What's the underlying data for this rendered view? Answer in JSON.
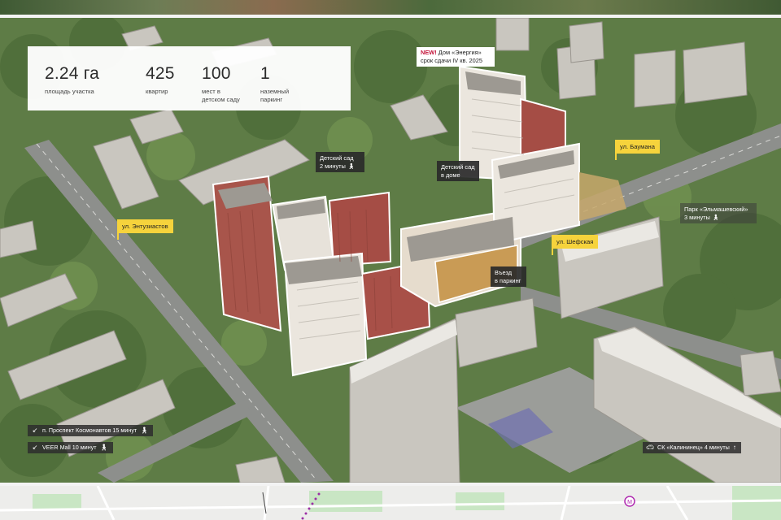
{
  "stats": [
    {
      "value": "2.24 га",
      "label": "площадь участка"
    },
    {
      "value": "425",
      "label": "квартир"
    },
    {
      "value": "100",
      "label": "мест в детском саду"
    },
    {
      "value": "1",
      "label": "наземный паркинг"
    }
  ],
  "new_building": {
    "new_tag": "NEW!",
    "title": "Дом «Энергия»",
    "deadline": "срок сдачи IV кв. 2025"
  },
  "callouts": {
    "kindergarten_near": {
      "line1": "Детский сад",
      "line2": "2 минуты",
      "icon": "walk-icon"
    },
    "kindergarten_home": {
      "line1": "Детский сад",
      "line2": "в доме"
    },
    "parking_entry": {
      "line1": "Въезд",
      "line2": "в паркинг"
    },
    "park": {
      "line1": "Парк «Эльмашевский»",
      "line2": "3 минуты",
      "icon": "walk-icon"
    }
  },
  "streets": {
    "baumana": "ул. Баумана",
    "entuziastov": "ул. Энтузиастов",
    "shefskaya": "ул. Шефская"
  },
  "travel": {
    "kosmonavtov": {
      "text": "п. Проспект Космонавтов 15 минут",
      "icon": "walk-icon"
    },
    "veer_mall": {
      "text": "VEER Mall 10 минут",
      "icon": "walk-icon"
    },
    "kalininets": {
      "text": "СК «Калининец» 4 минуты",
      "icon": "car-icon"
    }
  },
  "colors": {
    "accent_yellow": "#f6d33c",
    "callout_dark": "#2a2a2a",
    "new_red": "#c4163c",
    "brick": "#a54d45"
  }
}
